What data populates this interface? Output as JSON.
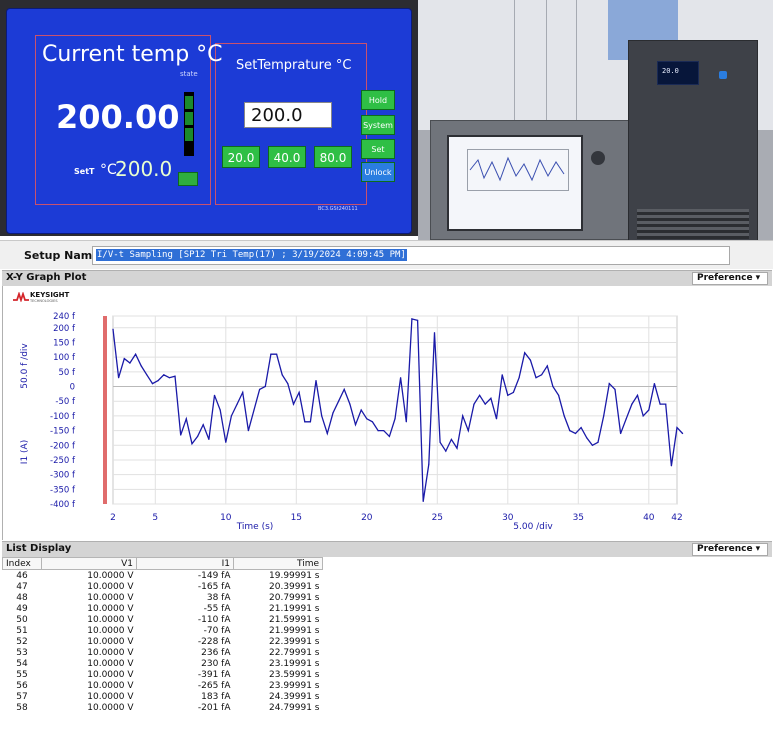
{
  "hmi": {
    "current_title": "Current  temp  °C",
    "state_label": "state",
    "current_value": "200.00",
    "set_label": "SetT",
    "set_unit": "°C",
    "set_value": "200.0",
    "set_title": "SetTemprature  °C",
    "input_value": "200.0",
    "presets": [
      "20.0",
      "40.0",
      "80.0"
    ],
    "side_buttons": [
      "Hold",
      "System",
      "Set",
      "Unlock"
    ],
    "code": "BC3.GSt240111"
  },
  "chamber": {
    "display_text": "20.0"
  },
  "setup": {
    "label": "Setup Name :",
    "value": "I/V-t Sampling [SP12 Tri Temp(17) ; 3/19/2024 4:09:45 PM]"
  },
  "graph": {
    "section_title": "X-Y Graph Plot",
    "preference_label": "Preference ▾",
    "brand": "KEYSIGHT",
    "brand_sub": "TECHNOLOGIES",
    "y_div_label": "50.0 f /div",
    "y_axis_label": "I1 (A)",
    "x_axis_label": "Time (s)",
    "x_div_label": "5.00 /div",
    "series_color": "#1a1aa8",
    "cursor_color": "#e06c6c"
  },
  "chart_data": {
    "type": "line",
    "title": "",
    "xlabel": "Time (s)",
    "ylabel": "I1 (A)",
    "xlim": [
      2,
      42
    ],
    "ylim": [
      -400,
      240
    ],
    "x_ticks": [
      2,
      5,
      10,
      15,
      20,
      25,
      30,
      35,
      40,
      42
    ],
    "y_ticks": [
      {
        "v": 240,
        "label": "240 f"
      },
      {
        "v": 200,
        "label": "200 f"
      },
      {
        "v": 150,
        "label": "150 f"
      },
      {
        "v": 100,
        "label": "100 f"
      },
      {
        "v": 50,
        "label": "50 f"
      },
      {
        "v": 0,
        "label": "0"
      },
      {
        "v": -50,
        "label": "-50 f"
      },
      {
        "v": -100,
        "label": "-100 f"
      },
      {
        "v": -150,
        "label": "-150 f"
      },
      {
        "v": -200,
        "label": "-200 f"
      },
      {
        "v": -250,
        "label": "-250 f"
      },
      {
        "v": -300,
        "label": "-300 f"
      },
      {
        "v": -350,
        "label": "-350 f"
      },
      {
        "v": -400,
        "label": "-400 f"
      }
    ],
    "grid": true,
    "series": [
      {
        "values": [
          [
            2.0,
            195
          ],
          [
            2.4,
            30
          ],
          [
            2.8,
            95
          ],
          [
            3.2,
            80
          ],
          [
            3.6,
            110
          ],
          [
            4.0,
            70
          ],
          [
            4.4,
            40
          ],
          [
            4.8,
            10
          ],
          [
            5.2,
            20
          ],
          [
            5.6,
            40
          ],
          [
            6.0,
            30
          ],
          [
            6.4,
            35
          ],
          [
            6.8,
            -165
          ],
          [
            7.2,
            -110
          ],
          [
            7.6,
            -195
          ],
          [
            8.0,
            -170
          ],
          [
            8.4,
            -130
          ],
          [
            8.8,
            -180
          ],
          [
            9.2,
            -30
          ],
          [
            9.6,
            -80
          ],
          [
            10.0,
            -190
          ],
          [
            10.4,
            -100
          ],
          [
            10.8,
            -60
          ],
          [
            11.2,
            -20
          ],
          [
            11.6,
            -150
          ],
          [
            12.0,
            -80
          ],
          [
            12.4,
            -10
          ],
          [
            12.8,
            0
          ],
          [
            13.2,
            110
          ],
          [
            13.6,
            110
          ],
          [
            14.0,
            40
          ],
          [
            14.4,
            10
          ],
          [
            14.8,
            -60
          ],
          [
            15.2,
            -20
          ],
          [
            15.6,
            -120
          ],
          [
            16.0,
            -120
          ],
          [
            16.4,
            20
          ],
          [
            16.8,
            -100
          ],
          [
            17.2,
            -160
          ],
          [
            17.6,
            -90
          ],
          [
            18.0,
            -50
          ],
          [
            18.4,
            -10
          ],
          [
            18.8,
            -60
          ],
          [
            19.2,
            -130
          ],
          [
            19.6,
            -80
          ],
          [
            20.0,
            -110
          ],
          [
            20.4,
            -120
          ],
          [
            20.8,
            -150
          ],
          [
            21.2,
            -150
          ],
          [
            21.6,
            -170
          ],
          [
            22.0,
            -110
          ],
          [
            22.4,
            30
          ],
          [
            22.8,
            -120
          ],
          [
            23.2,
            230
          ],
          [
            23.6,
            225
          ],
          [
            24.0,
            -391
          ],
          [
            24.4,
            -265
          ],
          [
            24.8,
            183
          ],
          [
            25.2,
            -190
          ],
          [
            25.6,
            -220
          ],
          [
            26.0,
            -180
          ],
          [
            26.4,
            -210
          ],
          [
            26.8,
            -100
          ],
          [
            27.2,
            -150
          ],
          [
            27.6,
            -60
          ],
          [
            28.0,
            -30
          ],
          [
            28.4,
            -60
          ],
          [
            28.8,
            -40
          ],
          [
            29.2,
            -110
          ],
          [
            29.6,
            40
          ],
          [
            30.0,
            -30
          ],
          [
            30.4,
            -20
          ],
          [
            30.8,
            30
          ],
          [
            31.2,
            115
          ],
          [
            31.6,
            90
          ],
          [
            32.0,
            30
          ],
          [
            32.4,
            40
          ],
          [
            32.8,
            70
          ],
          [
            33.2,
            0
          ],
          [
            33.6,
            -30
          ],
          [
            34.0,
            -100
          ],
          [
            34.4,
            -150
          ],
          [
            34.8,
            -160
          ],
          [
            35.2,
            -140
          ],
          [
            35.6,
            -175
          ],
          [
            36.0,
            -200
          ],
          [
            36.4,
            -190
          ],
          [
            36.8,
            -100
          ],
          [
            37.2,
            10
          ],
          [
            37.6,
            -10
          ],
          [
            38.0,
            -160
          ],
          [
            38.4,
            -110
          ],
          [
            38.8,
            -60
          ],
          [
            39.2,
            -30
          ],
          [
            39.6,
            -100
          ],
          [
            40.0,
            -80
          ],
          [
            40.4,
            10
          ],
          [
            40.8,
            -60
          ],
          [
            41.2,
            -60
          ],
          [
            41.6,
            -270
          ],
          [
            42.0,
            -140
          ],
          [
            42.4,
            -160
          ]
        ]
      }
    ]
  },
  "list": {
    "section_title": "List Display",
    "preference_label": "Preference ▾",
    "columns": [
      "Index",
      "V1",
      "I1",
      "Time"
    ],
    "rows": [
      [
        "46",
        "10.0000 V",
        "-149 fA",
        "19.99991 s"
      ],
      [
        "47",
        "10.0000 V",
        "-165 fA",
        "20.39991 s"
      ],
      [
        "48",
        "10.0000 V",
        "38 fA",
        "20.79991 s"
      ],
      [
        "49",
        "10.0000 V",
        "-55 fA",
        "21.19991 s"
      ],
      [
        "50",
        "10.0000 V",
        "-110 fA",
        "21.59991 s"
      ],
      [
        "51",
        "10.0000 V",
        "-70 fA",
        "21.99991 s"
      ],
      [
        "52",
        "10.0000 V",
        "-228 fA",
        "22.39991 s"
      ],
      [
        "53",
        "10.0000 V",
        "236 fA",
        "22.79991 s"
      ],
      [
        "54",
        "10.0000 V",
        "230 fA",
        "23.19991 s"
      ],
      [
        "55",
        "10.0000 V",
        "-391 fA",
        "23.59991 s"
      ],
      [
        "56",
        "10.0000 V",
        "-265 fA",
        "23.99991 s"
      ],
      [
        "57",
        "10.0000 V",
        "183 fA",
        "24.39991 s"
      ],
      [
        "58",
        "10.0000 V",
        "-201 fA",
        "24.79991 s"
      ]
    ]
  }
}
